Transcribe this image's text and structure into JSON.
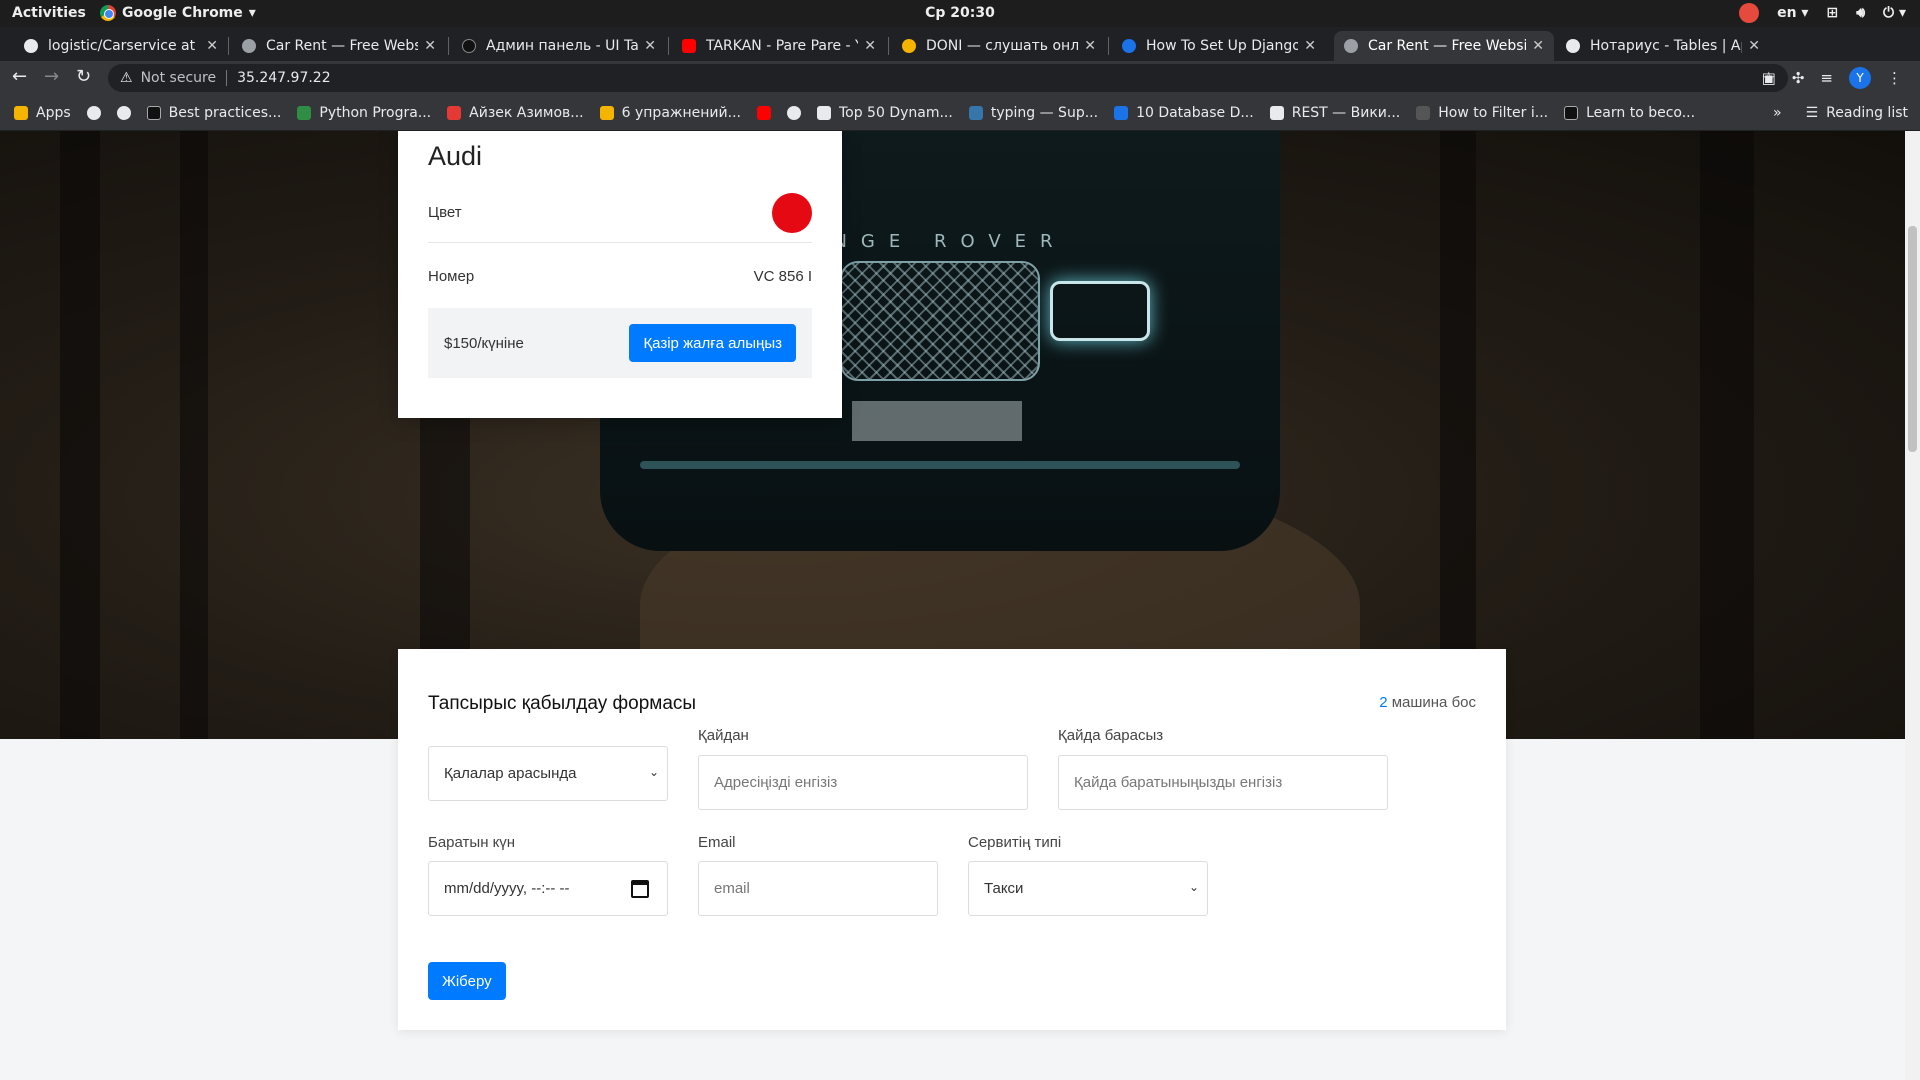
{
  "system": {
    "activities": "Activities",
    "app_name": "Google Chrome",
    "clock": "Ср 20:30",
    "lang": "en"
  },
  "tabs": [
    {
      "title": "logistic/Carservice at m",
      "color": "#e8eaed"
    },
    {
      "title": "Car Rent — Free Websi",
      "color": "#9aa0a6"
    },
    {
      "title": "Админ панель - UI Tab",
      "color": "#111111"
    },
    {
      "title": "TARKAN - Pare Pare - Yo",
      "color": "#ff0000"
    },
    {
      "title": "DONI — слушать онла",
      "color": "#f4b400"
    },
    {
      "title": "How To Set Up Django",
      "color": "#1a73e8"
    },
    {
      "title": "Car Rent — Free Websi",
      "color": "#9aa0a6"
    },
    {
      "title": "Нотариус - Tables | Ap",
      "color": "#e8eaed"
    }
  ],
  "omnibox": {
    "security_text": "Not secure",
    "url": "35.247.97.22"
  },
  "bookmarks": [
    {
      "label": "Apps",
      "color": "#f4b400"
    },
    {
      "label": "",
      "color": "#e8eaed"
    },
    {
      "label": "",
      "color": "#e8eaed"
    },
    {
      "label": "Best practices...",
      "color": "#111111"
    },
    {
      "label": "Python Progra...",
      "color": "#2f8d46"
    },
    {
      "label": "Айзек Азимов...",
      "color": "#e53935"
    },
    {
      "label": "6 упражнений...",
      "color": "#f4b400"
    },
    {
      "label": "",
      "color": "#ff0000"
    },
    {
      "label": "",
      "color": "#e8eaed"
    },
    {
      "label": "Top 50 Dynam...",
      "color": "#e8eaed"
    },
    {
      "label": "typing — Sup...",
      "color": "#3776ab"
    },
    {
      "label": "10 Database D...",
      "color": "#1a73e8"
    },
    {
      "label": "REST — Вики...",
      "color": "#e8eaed"
    },
    {
      "label": "How to Filter i...",
      "color": "#555555"
    },
    {
      "label": "Learn to beco...",
      "color": "#111111"
    }
  ],
  "bookmarks_more": "»",
  "reading_list": "Reading list",
  "car_card": {
    "name": "Audi",
    "color_label": "Цвет",
    "color_value": "#e50914",
    "plate_label": "Номер",
    "plate_value": "VC 856 I",
    "price": "$150/күніне",
    "rent_button": "Қазір жалға алыңыз"
  },
  "hero": {
    "car_badge": "NGE ROVER"
  },
  "order_form": {
    "title": "Тапсырыс қабылдау формасы",
    "available_count": "2",
    "available_text": "машина бос",
    "route_type": "Қалалар арасында",
    "from_label": "Қайдан",
    "from_placeholder": "Адресіңізді енгізіз",
    "to_label": "Қайда барасыз",
    "to_placeholder": "Қайда баратыныңызды енгізіз",
    "date_label": "Баратын күн",
    "date_placeholder": "mm/dd/yyyy, --:-- --",
    "email_label": "Email",
    "email_placeholder": "email",
    "service_label": "Сервитің типі",
    "service_value": "Такси",
    "submit": "Жіберу"
  },
  "colors": {
    "accent": "#007bff",
    "chrome_dark": "#202124",
    "chrome_mid": "#35363a"
  }
}
